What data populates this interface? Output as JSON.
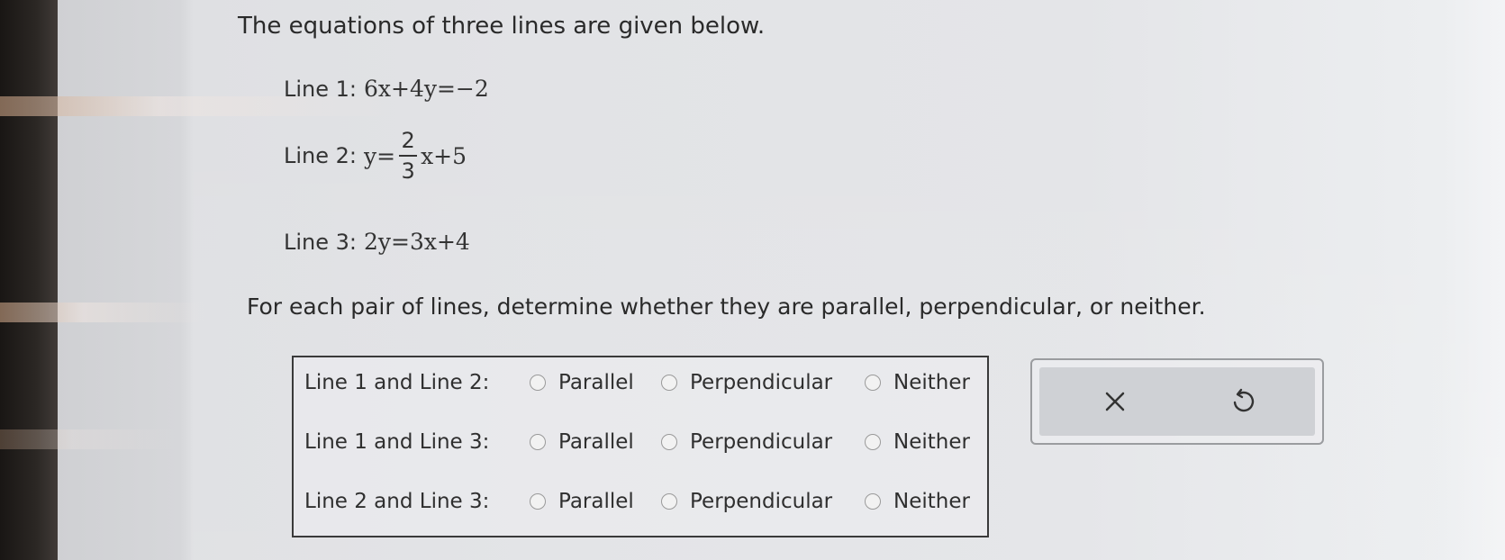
{
  "question": {
    "intro": "The equations of three lines are given below.",
    "lines": [
      {
        "label": "Line 1:",
        "equation": "6x+4y=−2"
      },
      {
        "label": "Line 2:",
        "prefix": "y=",
        "fraction": {
          "numerator": "2",
          "denominator": "3"
        },
        "suffix": "x+5"
      },
      {
        "label": "Line 3:",
        "equation": "2y=3x+4"
      }
    ],
    "prompt": "For each pair of lines, determine whether they are parallel, perpendicular, or neither."
  },
  "answer_table": {
    "rows": [
      {
        "label": "Line 1 and Line 2:",
        "options": [
          "Parallel",
          "Perpendicular",
          "Neither"
        ]
      },
      {
        "label": "Line 1 and Line 3:",
        "options": [
          "Parallel",
          "Perpendicular",
          "Neither"
        ]
      },
      {
        "label": "Line 2 and Line 3:",
        "options": [
          "Parallel",
          "Perpendicular",
          "Neither"
        ]
      }
    ]
  },
  "controls": {
    "clear_icon": "close-icon",
    "undo_icon": "undo-icon"
  }
}
